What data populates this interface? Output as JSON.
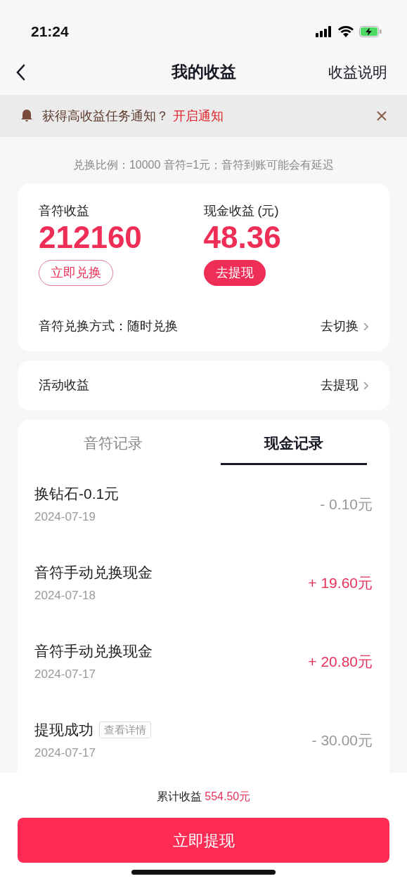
{
  "status_bar": {
    "time": "21:24"
  },
  "nav": {
    "title": "我的收益",
    "action": "收益说明"
  },
  "notice": {
    "text": "获得高收益任务通知？",
    "link": "开启通知"
  },
  "ratio_note": "兑换比例：10000 音符=1元；音符到账可能会有延迟",
  "earnings": [
    {
      "label": "音符收益",
      "value": "212160",
      "button": "立即兑换",
      "kind": "outline"
    },
    {
      "label": "现金收益 (元)",
      "value": "48.36",
      "button": "去提现",
      "kind": "filled"
    }
  ],
  "exchange_mode": {
    "label": "音符兑换方式：随时兑换",
    "action": "去切换"
  },
  "activity": {
    "label": "活动收益",
    "action": "去提现"
  },
  "tabs": [
    {
      "label": "音符记录",
      "selected": false
    },
    {
      "label": "现金记录",
      "selected": true
    }
  ],
  "records": [
    {
      "title": "换钻石-0.1元",
      "date": "2024-07-19",
      "amount": "- 0.10元",
      "kind": "expense"
    },
    {
      "title": "音符手动兑换现金",
      "date": "2024-07-18",
      "amount": "+ 19.60元",
      "kind": "income"
    },
    {
      "title": "音符手动兑换现金",
      "date": "2024-07-17",
      "amount": "+ 20.80元",
      "kind": "income"
    },
    {
      "title": "提现成功",
      "tag": "查看详情",
      "date": "2024-07-17",
      "amount": "- 30.00元",
      "kind": "expense"
    }
  ],
  "footer": {
    "total_label": "累计收益",
    "total_value": "554.50元",
    "button": "立即提现"
  }
}
